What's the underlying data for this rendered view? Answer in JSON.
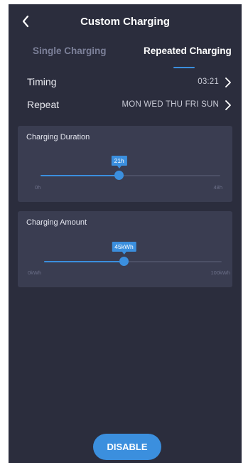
{
  "header": {
    "title": "Custom Charging",
    "back_icon": "chevron-left-icon"
  },
  "tabs": [
    {
      "label": "Single Charging",
      "active": false
    },
    {
      "label": "Repeated Charging",
      "active": true
    }
  ],
  "timing": {
    "label": "Timing",
    "value": "03:21",
    "icon": "chevron-right-icon"
  },
  "repeat": {
    "label": "Repeat",
    "value": "MON WED THU FRI SUN",
    "icon": "chevron-right-icon"
  },
  "duration": {
    "title": "Charging Duration",
    "value_label": "21h",
    "min_label": "0h",
    "max_label": "48h",
    "value": 21,
    "min": 0,
    "max": 48
  },
  "amount": {
    "title": "Charging Amount",
    "value_label": "45kWh",
    "min_label": "0kWh",
    "max_label": "100kWh",
    "value": 45,
    "min": 0,
    "max": 100
  },
  "footer": {
    "disable_label": "DISABLE"
  },
  "colors": {
    "background": "#2b2d3d",
    "card": "#3a3d51",
    "accent": "#3b8fde",
    "muted_text": "#7c8099"
  }
}
